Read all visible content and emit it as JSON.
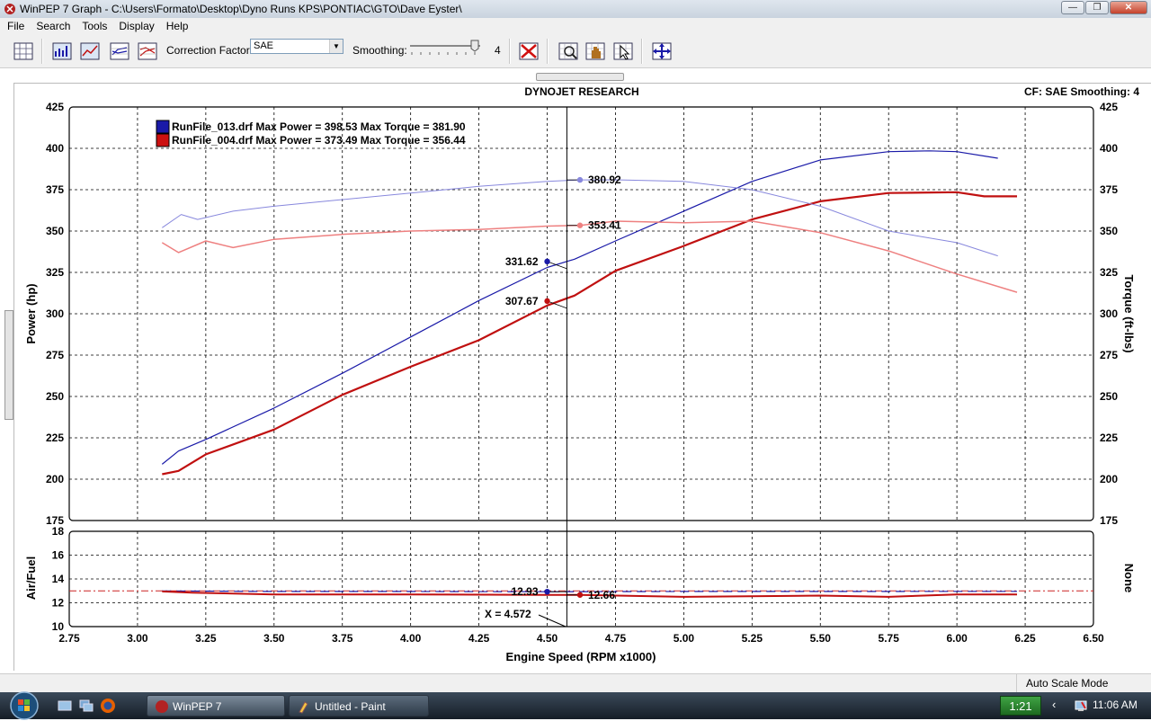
{
  "window": {
    "title": "WinPEP 7    Graph - C:\\Users\\Formato\\Desktop\\Dyno Runs KPS\\PONTIAC\\GTO\\Dave Eyster\\",
    "min_glyph": "—",
    "max_glyph": "❐",
    "close_glyph": "✕"
  },
  "menu": [
    "File",
    "Search",
    "Tools",
    "Display",
    "Help"
  ],
  "toolbar": {
    "correction_label": "Correction Factor:",
    "correction_value": "SAE",
    "smoothing_label": "Smoothing:",
    "smoothing_value": "4"
  },
  "graph": {
    "header_title": "DYNOJET RESEARCH",
    "header_cf": "CF: SAE  Smoothing: 4"
  },
  "chart_data": [
    {
      "type": "line",
      "xlabel": "Engine Speed (RPM x1000)",
      "ylabel": "Power (hp)",
      "y2label": "Torque (ft-lbs)",
      "xlim": [
        2.75,
        6.5
      ],
      "ylim": [
        175,
        425
      ],
      "y2lim": [
        175,
        425
      ],
      "x_ticks": [
        "2.75",
        "3.00",
        "3.25",
        "3.50",
        "3.75",
        "4.00",
        "4.25",
        "4.50",
        "4.75",
        "5.00",
        "5.25",
        "5.50",
        "5.75",
        "6.00",
        "6.25",
        "6.50"
      ],
      "y_ticks": [
        "175",
        "200",
        "225",
        "250",
        "275",
        "300",
        "325",
        "350",
        "375",
        "400",
        "425"
      ],
      "grid": true,
      "legend": "top-left",
      "legend_entries": [
        {
          "name": "RunFile_013.drf",
          "text": "RunFile_013.drf Max Power = 398.53 Max Torque = 381.90",
          "color": "#1a1aa8"
        },
        {
          "name": "RunFile_004.drf",
          "text": "RunFile_004.drf Max Power = 373.49 Max Torque = 356.44",
          "color": "#cc1111"
        }
      ],
      "series": [
        {
          "name": "RunFile_013.drf Power",
          "color": "#1a1aa8",
          "width": 1.2,
          "x": [
            3.09,
            3.15,
            3.25,
            3.5,
            3.75,
            4.0,
            4.25,
            4.5,
            4.6,
            4.75,
            5.0,
            5.25,
            5.5,
            5.75,
            5.9,
            6.0,
            6.15
          ],
          "y": [
            209,
            217,
            224,
            243,
            264,
            286,
            308,
            328,
            333,
            344,
            362,
            380,
            393,
            398,
            398.5,
            398,
            394
          ]
        },
        {
          "name": "RunFile_004.drf Power",
          "color": "#c01010",
          "width": 2.2,
          "x": [
            3.09,
            3.15,
            3.25,
            3.5,
            3.75,
            4.0,
            4.25,
            4.5,
            4.6,
            4.75,
            5.0,
            5.25,
            5.5,
            5.75,
            6.0,
            6.1,
            6.22
          ],
          "y": [
            203,
            205,
            215,
            230,
            251,
            268,
            284,
            305,
            311,
            326,
            341,
            357,
            368,
            373,
            373.5,
            371,
            371
          ]
        },
        {
          "name": "RunFile_013.drf Torque",
          "color": "#8888dd",
          "width": 1,
          "x": [
            3.09,
            3.16,
            3.22,
            3.35,
            3.5,
            3.75,
            4.0,
            4.25,
            4.5,
            4.62,
            4.75,
            5.0,
            5.25,
            5.5,
            5.75,
            6.0,
            6.15
          ],
          "y": [
            352,
            360,
            357,
            362,
            365,
            369,
            373,
            377,
            380,
            380.9,
            381,
            380,
            375,
            365,
            350,
            343,
            335
          ]
        },
        {
          "name": "RunFile_004.drf Torque",
          "color": "#ee8080",
          "width": 1.5,
          "x": [
            3.09,
            3.15,
            3.25,
            3.35,
            3.5,
            3.75,
            4.0,
            4.25,
            4.5,
            4.62,
            4.75,
            5.0,
            5.25,
            5.5,
            5.75,
            6.0,
            6.22
          ],
          "y": [
            343,
            337,
            344,
            340,
            345,
            348,
            350,
            351,
            353,
            353.4,
            356,
            355,
            356,
            349,
            338,
            324,
            313
          ]
        }
      ],
      "cursor": {
        "x": 4.572
      },
      "markers": [
        {
          "label": "380.92",
          "x": 4.62,
          "y": 380.92,
          "color": "#8888dd",
          "side": "right"
        },
        {
          "label": "353.41",
          "x": 4.62,
          "y": 353.41,
          "color": "#ee8080",
          "side": "right"
        },
        {
          "label": "331.62",
          "x": 4.5,
          "y": 331.62,
          "color": "#1a1aa8",
          "side": "left"
        },
        {
          "label": "307.67",
          "x": 4.5,
          "y": 307.67,
          "color": "#c01010",
          "side": "left"
        }
      ]
    },
    {
      "type": "line",
      "ylabel": "Air/Fuel",
      "y2label": "None",
      "xlim": [
        2.75,
        6.5
      ],
      "ylim": [
        10,
        18
      ],
      "y_ticks": [
        "10",
        "12",
        "14",
        "16",
        "18"
      ],
      "grid": true,
      "reference_line": {
        "y": 13,
        "color": "#cc2222"
      },
      "series": [
        {
          "name": "RunFile_013.drf Air/Fuel",
          "color": "#1a1aa8",
          "x": [
            3.09,
            3.5,
            4.0,
            4.5,
            5.0,
            5.5,
            6.0,
            6.22
          ],
          "y": [
            13.0,
            12.95,
            12.95,
            12.93,
            12.95,
            12.95,
            12.96,
            12.96
          ]
        },
        {
          "name": "RunFile_004.drf Air/Fuel",
          "color": "#c01010",
          "x": [
            3.09,
            3.2,
            3.5,
            4.0,
            4.5,
            4.62,
            5.0,
            5.5,
            5.75,
            6.0,
            6.22
          ],
          "y": [
            12.95,
            12.85,
            12.7,
            12.7,
            12.66,
            12.66,
            12.5,
            12.6,
            12.5,
            12.7,
            12.7
          ]
        }
      ],
      "markers": [
        {
          "label": "12.93",
          "x": 4.5,
          "y": 12.93,
          "color": "#1a1aa8",
          "side": "left"
        },
        {
          "label": "12.66",
          "x": 4.62,
          "y": 12.66,
          "color": "#c01010",
          "side": "right"
        }
      ],
      "cursor_label": "X = 4.572"
    }
  ],
  "status": {
    "mode": "Auto Scale Mode"
  },
  "taskbar": {
    "tasks": [
      "WinPEP 7",
      "Untitled - Paint"
    ],
    "timer": "1:21",
    "clock": "11:06 AM"
  }
}
